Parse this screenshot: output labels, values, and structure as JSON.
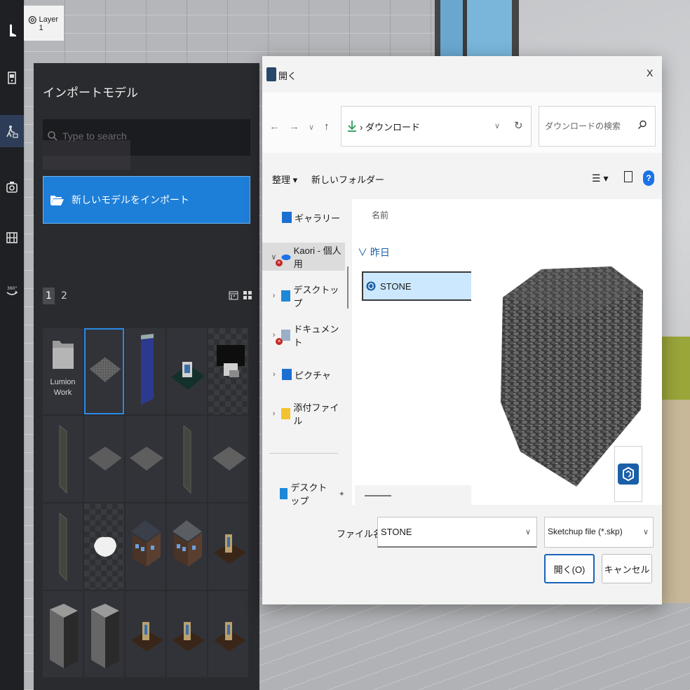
{
  "layer": {
    "label": "Layer 1"
  },
  "panel": {
    "title": "インポートモデル",
    "search_placeholder": "Type to search",
    "import_button": "新しいモデルをインポート",
    "pages": [
      "1",
      "2"
    ],
    "folder_label_line1": "Lumion",
    "folder_label_line2": "Work"
  },
  "dialog": {
    "title": "開く",
    "close": "X",
    "nav": {
      "back": "←",
      "forward": "→",
      "down": "∨",
      "up": "↑"
    },
    "address": "ダウンロード",
    "search_placeholder": "ダウンロードの検索",
    "organize": "整理 ▾",
    "new_folder": "新しいフォルダー",
    "help": "?",
    "nav_pane": [
      {
        "label": "ギャラリー"
      },
      {
        "label": "Kaori - 個人用"
      },
      {
        "label": "デスクトップ"
      },
      {
        "label": "ドキュメント"
      },
      {
        "label": "ピクチャ"
      },
      {
        "label": "添付ファイル"
      },
      {
        "label": "デスクトップ"
      }
    ],
    "column_header": "名前",
    "group_label": "昨日",
    "file_name_item": "STONE",
    "filename_label": "ファイル名(N):",
    "filename_value": "STONE",
    "filetype_value": "Sketchup file (*.skp)",
    "open_button": "開く(O)",
    "cancel_button": "キャンセル"
  },
  "colors": {
    "accent": "#1e7fd8",
    "panel_bg": "#2a2b2f",
    "toolbar_bg": "#1f2024",
    "selection": "#cce8ff"
  }
}
